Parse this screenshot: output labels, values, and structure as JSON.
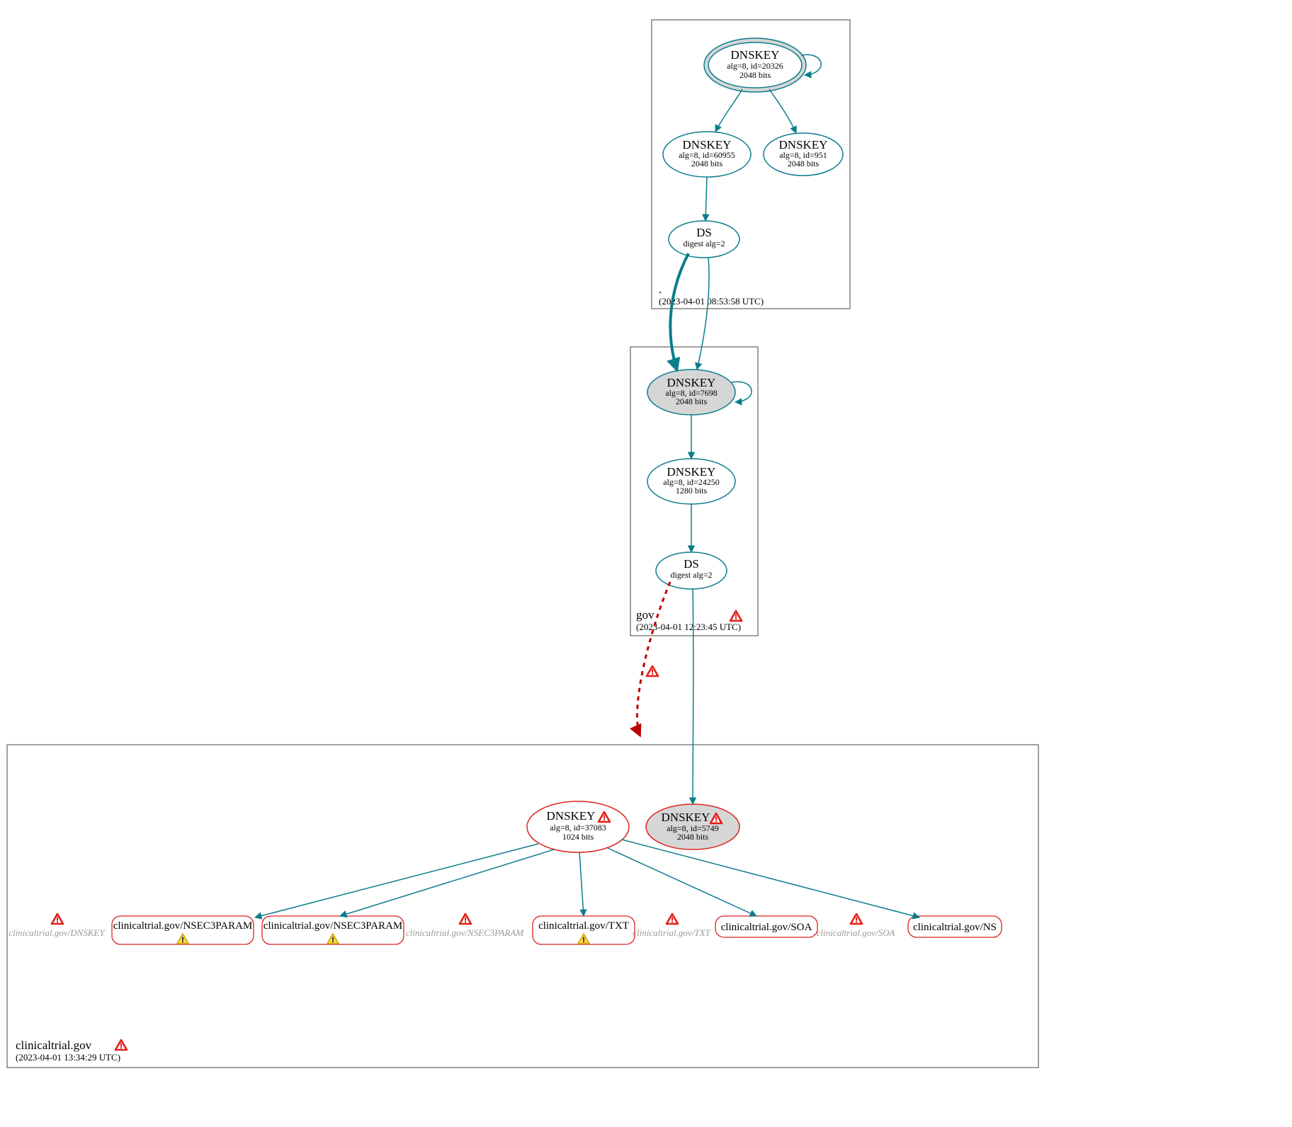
{
  "zones": {
    "root": {
      "name": ".",
      "timestamp": "(2023-04-01 08:53:58 UTC)"
    },
    "gov": {
      "name": "gov",
      "timestamp": "(2023-04-01 12:23:45 UTC)"
    },
    "leaf": {
      "name": "clinicaltrial.gov",
      "timestamp": "(2023-04-01 13:34:29 UTC)"
    }
  },
  "nodes": {
    "root_ksk": {
      "title": "DNSKEY",
      "line2": "alg=8, id=20326",
      "line3": "2048 bits"
    },
    "root_zsk1": {
      "title": "DNSKEY",
      "line2": "alg=8, id=60955",
      "line3": "2048 bits"
    },
    "root_zsk2": {
      "title": "DNSKEY",
      "line2": "alg=8, id=951",
      "line3": "2048 bits"
    },
    "root_ds": {
      "title": "DS",
      "line2": "digest alg=2",
      "line3": ""
    },
    "gov_ksk": {
      "title": "DNSKEY",
      "line2": "alg=8, id=7698",
      "line3": "2048 bits"
    },
    "gov_zsk": {
      "title": "DNSKEY",
      "line2": "alg=8, id=24250",
      "line3": "1280 bits"
    },
    "gov_ds": {
      "title": "DS",
      "line2": "digest alg=2",
      "line3": ""
    },
    "leaf_zsk": {
      "title": "DNSKEY",
      "line2": "alg=8, id=37083",
      "line3": "1024 bits"
    },
    "leaf_ksk": {
      "title": "DNSKEY",
      "line2": "alg=8, id=5749",
      "line3": "2048 bits"
    }
  },
  "rrsets": {
    "grey_dnskey": "clinicaltrial.gov/DNSKEY",
    "nsec3p1": "clinicaltrial.gov/NSEC3PARAM",
    "nsec3p2": "clinicaltrial.gov/NSEC3PARAM",
    "grey_nsec3param": "clinicaltrial.gov/NSEC3PARAM",
    "txt": "clinicaltrial.gov/TXT",
    "grey_txt": "clinicaltrial.gov/TXT",
    "soa": "clinicaltrial.gov/SOA",
    "grey_soa": "clinicaltrial.gov/SOA",
    "ns": "clinicaltrial.gov/NS"
  },
  "colors": {
    "teal": "#0a7d8c",
    "red": "#d22",
    "grey": "#999",
    "warn_red": "#e21f18",
    "warn_yellow": "#ffd84a"
  }
}
